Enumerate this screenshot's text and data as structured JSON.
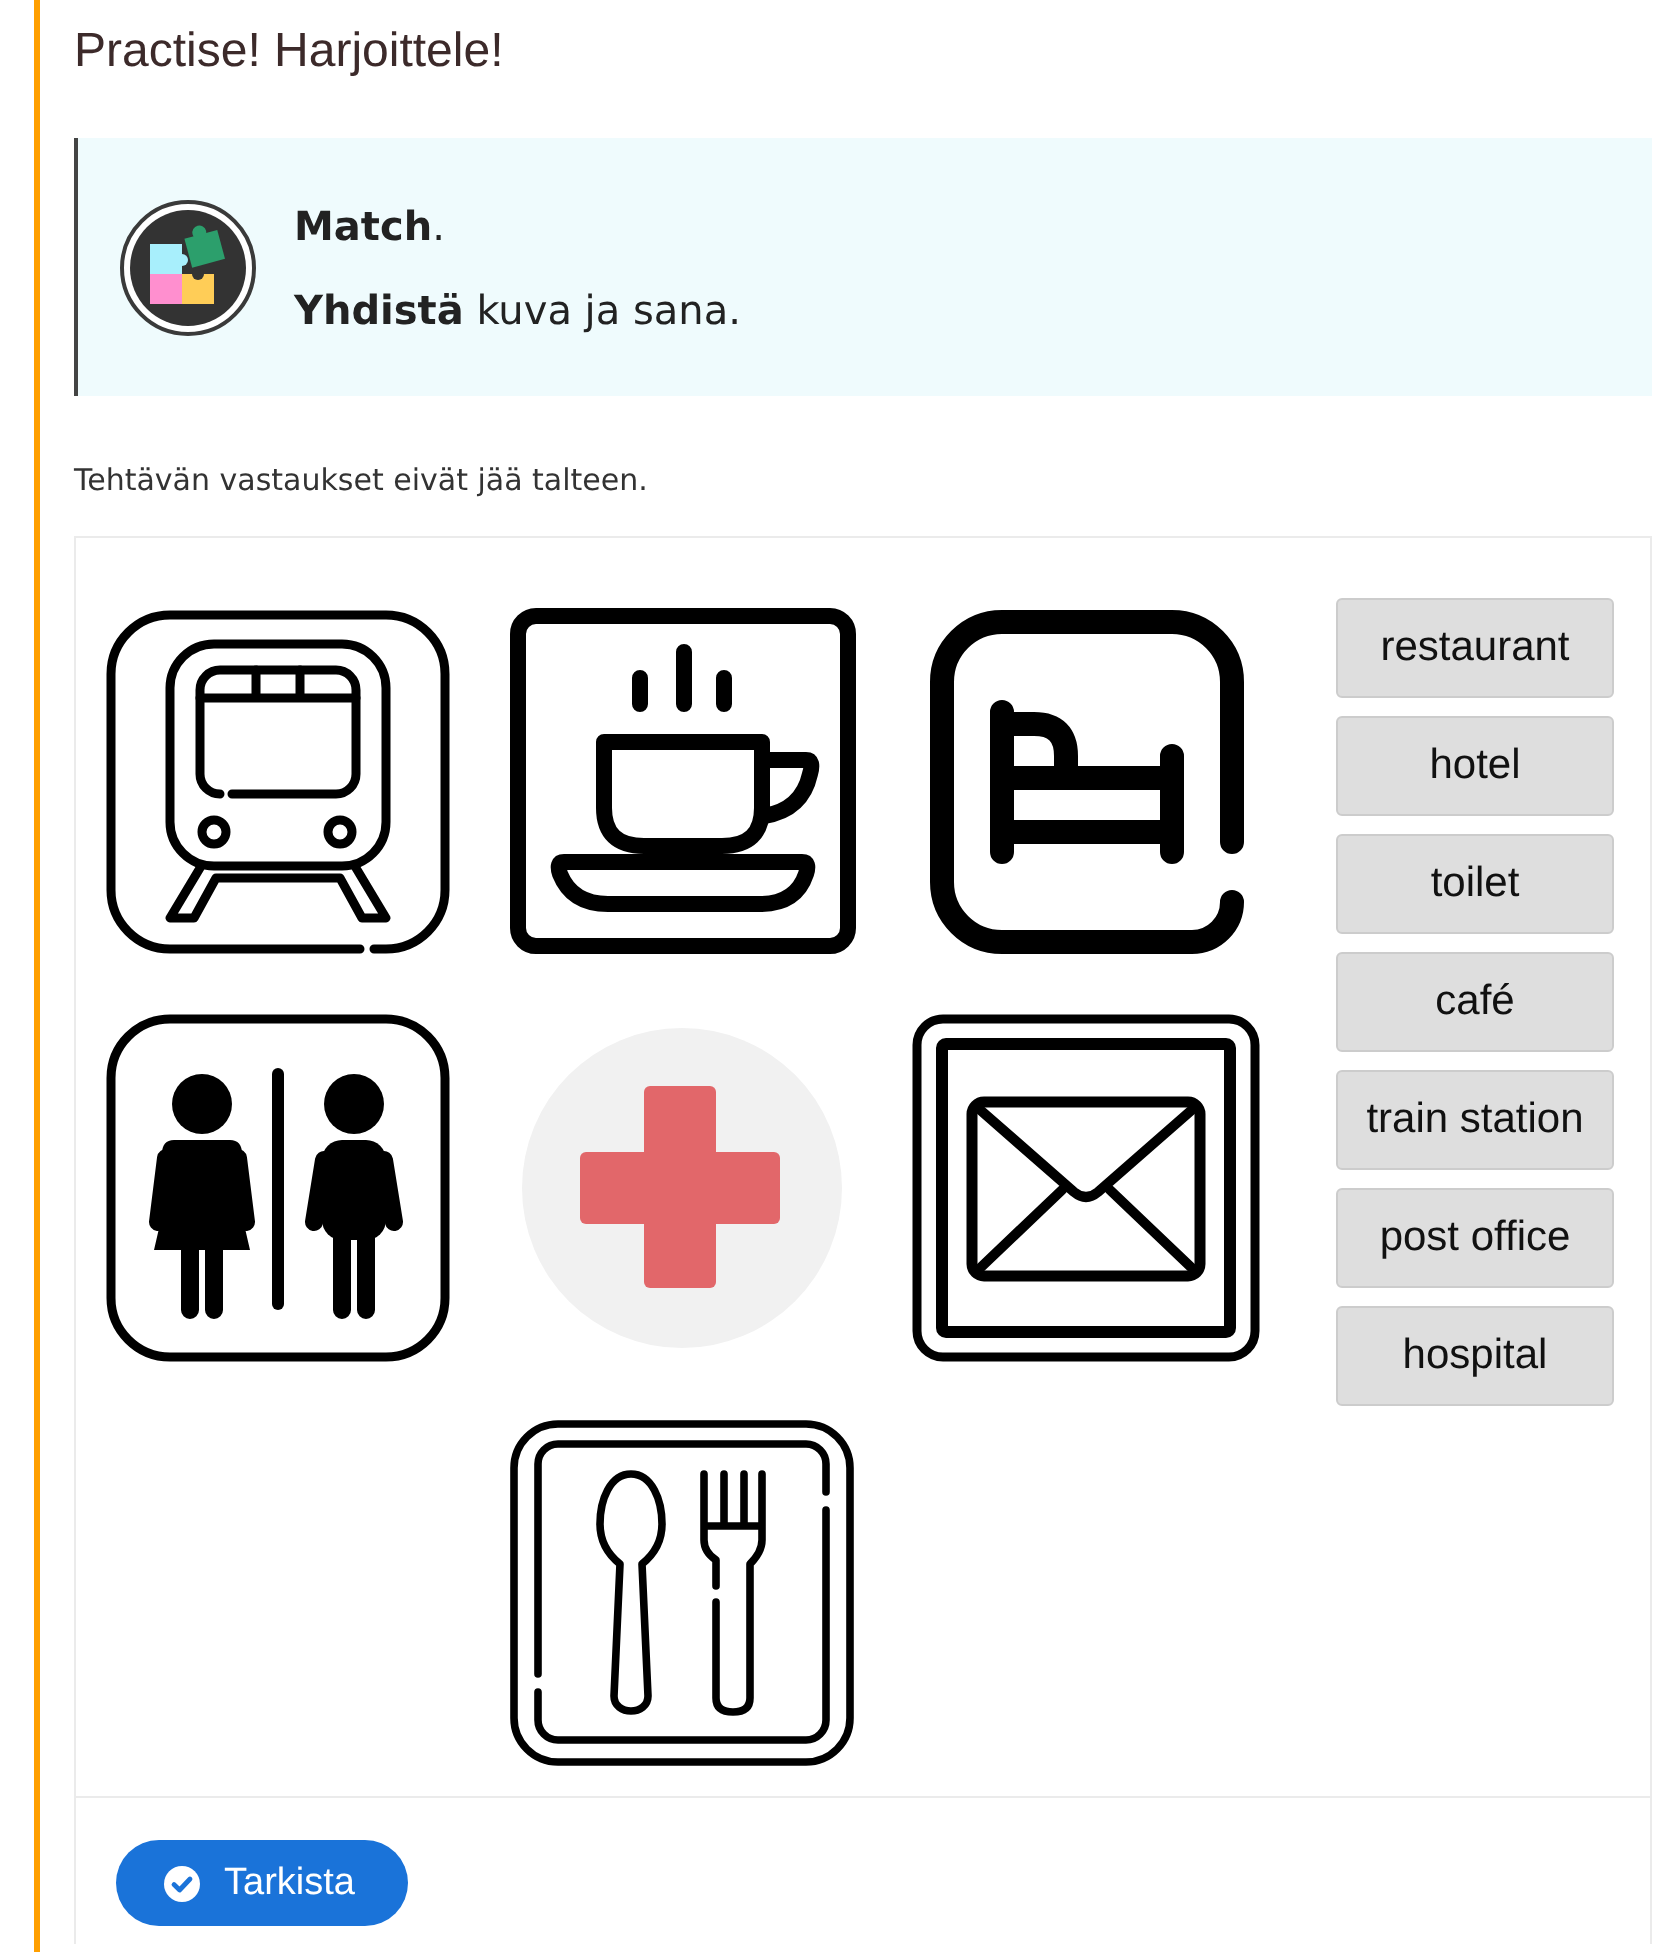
{
  "heading": "Practise! Harjoittele!",
  "instructions": {
    "lines": [
      "**Match**.",
      "**Yhdistä** kuva ja sana."
    ]
  },
  "note": "Tehtävän vastaukset eivät jää talteen.",
  "images": [
    {
      "kind": "train"
    },
    {
      "kind": "cafe"
    },
    {
      "kind": "hotel"
    },
    {
      "kind": "toilet"
    },
    {
      "kind": "hospital"
    },
    {
      "kind": "post_office"
    },
    {
      "kind": "restaurant"
    }
  ],
  "words": [
    "restaurant",
    "hotel",
    "toilet",
    "café",
    "train station",
    "post office",
    "hospital"
  ],
  "check_button": "Tarkista"
}
